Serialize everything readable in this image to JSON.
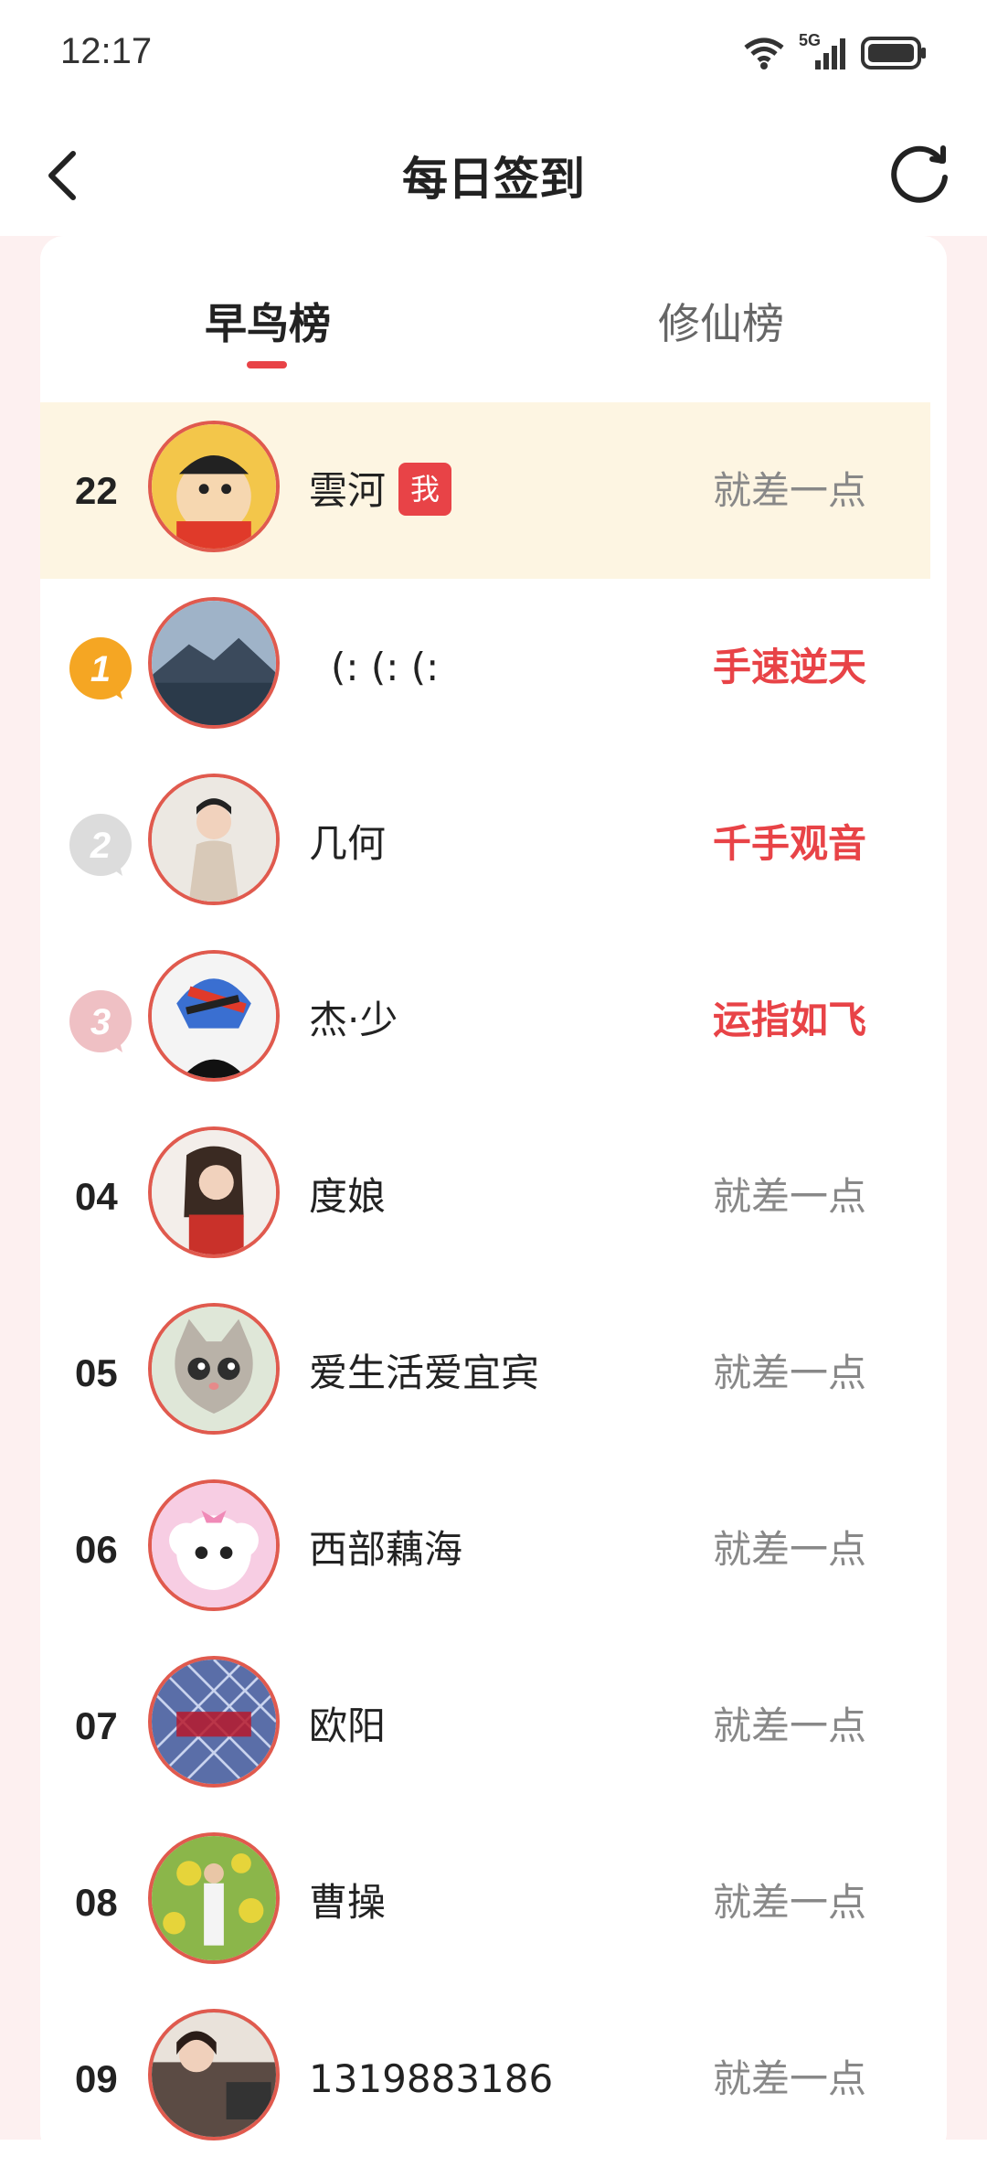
{
  "status_bar": {
    "time": "12:17",
    "network": "5G"
  },
  "header": {
    "title": "每日签到"
  },
  "tabs": [
    {
      "label": "早鸟榜",
      "active": true
    },
    {
      "label": "修仙榜",
      "active": false
    }
  ],
  "colors": {
    "accent": "#e84347",
    "highlight_row": "#fdf5e2",
    "page_bg": "#fdf0f0"
  },
  "me_row": {
    "rank": "22",
    "name": "雲河",
    "badge": "我",
    "status": "就差一点"
  },
  "rows": [
    {
      "rank": "1",
      "name": "(: (: (:",
      "status": "手速逆天",
      "medal": "gold-medal-icon"
    },
    {
      "rank": "2",
      "name": "几何",
      "status": "千手观音",
      "medal": "silver-medal-icon"
    },
    {
      "rank": "3",
      "name": "杰·少",
      "status": "运指如飞",
      "medal": "bronze-medal-icon"
    },
    {
      "rank": "04",
      "name": "度娘",
      "status": "就差一点"
    },
    {
      "rank": "05",
      "name": "爱生活爱宜宾",
      "status": "就差一点"
    },
    {
      "rank": "06",
      "name": "西部藕海",
      "status": "就差一点"
    },
    {
      "rank": "07",
      "name": "欧阳",
      "status": "就差一点"
    },
    {
      "rank": "08",
      "name": "曹操",
      "status": "就差一点"
    },
    {
      "rank": "09",
      "name": "1319883186",
      "status": "就差一点"
    }
  ]
}
